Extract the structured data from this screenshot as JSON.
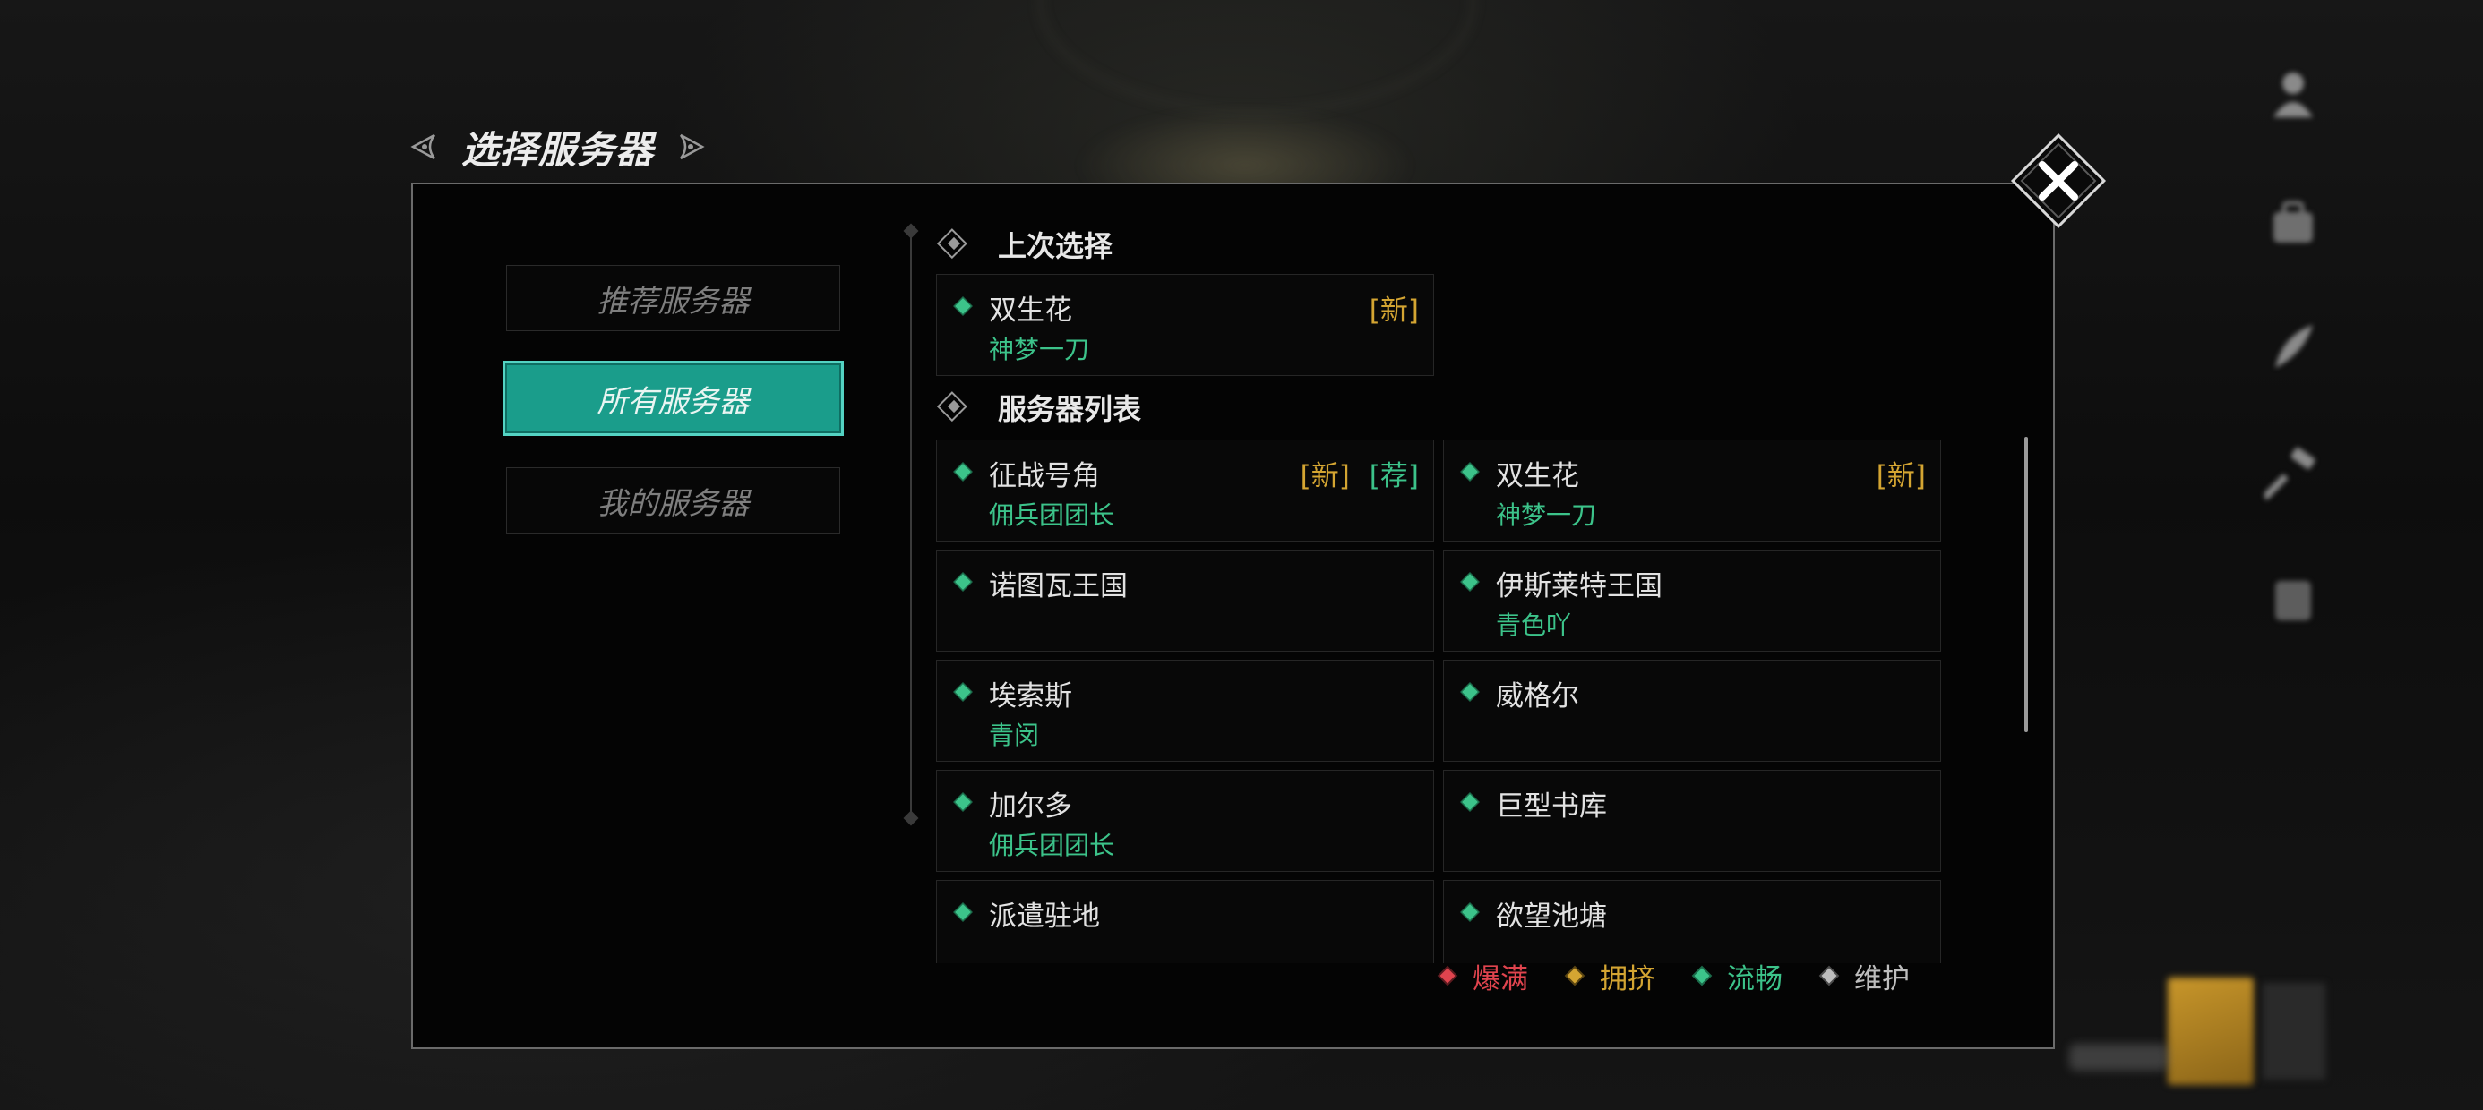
{
  "title": "选择服务器",
  "categories": [
    {
      "label": "推荐服务器",
      "active": false
    },
    {
      "label": "所有服务器",
      "active": true
    },
    {
      "label": "我的服务器",
      "active": false
    }
  ],
  "last_selection": {
    "header": "上次选择",
    "server": {
      "name": "双生花",
      "guild": "神梦一刀",
      "tags": [
        "[新]"
      ],
      "status": "smooth"
    }
  },
  "server_list": {
    "header": "服务器列表",
    "servers": [
      {
        "name": "征战号角",
        "guild": "佣兵团团长",
        "tag_new": "[新]",
        "tag_rec": "[荐]",
        "status": "smooth"
      },
      {
        "name": "双生花",
        "guild": "神梦一刀",
        "tag_new": "[新]",
        "tag_rec": "",
        "status": "smooth"
      },
      {
        "name": "诺图瓦王国",
        "guild": "",
        "tag_new": "",
        "tag_rec": "",
        "status": "smooth"
      },
      {
        "name": "伊斯莱特王国",
        "guild": "青色吖",
        "tag_new": "",
        "tag_rec": "",
        "status": "smooth"
      },
      {
        "name": "埃索斯",
        "guild": "青闵",
        "tag_new": "",
        "tag_rec": "",
        "status": "smooth"
      },
      {
        "name": "威格尔",
        "guild": "",
        "tag_new": "",
        "tag_rec": "",
        "status": "smooth"
      },
      {
        "name": "加尔多",
        "guild": "佣兵团团长",
        "tag_new": "",
        "tag_rec": "",
        "status": "smooth"
      },
      {
        "name": "巨型书库",
        "guild": "",
        "tag_new": "",
        "tag_rec": "",
        "status": "smooth"
      },
      {
        "name": "派遣驻地",
        "guild": "",
        "tag_new": "",
        "tag_rec": "",
        "status": "smooth"
      },
      {
        "name": "欲望池塘",
        "guild": "",
        "tag_new": "",
        "tag_rec": "",
        "status": "smooth"
      }
    ]
  },
  "legend": [
    {
      "label": "爆满",
      "color": "#e0444e",
      "icon": "red-diamond-icon"
    },
    {
      "label": "拥挤",
      "color": "#d4a532",
      "icon": "yellow-diamond-icon"
    },
    {
      "label": "流畅",
      "color": "#3cc38a",
      "icon": "green-diamond-icon"
    },
    {
      "label": "维护",
      "color": "#bdbdbd",
      "icon": "gray-diamond-icon"
    }
  ],
  "colors": {
    "accent": "#1a9d8b",
    "tag_new": "#d4a532",
    "tag_recommended": "#3cc38a",
    "guild_text": "#3cc38a"
  }
}
